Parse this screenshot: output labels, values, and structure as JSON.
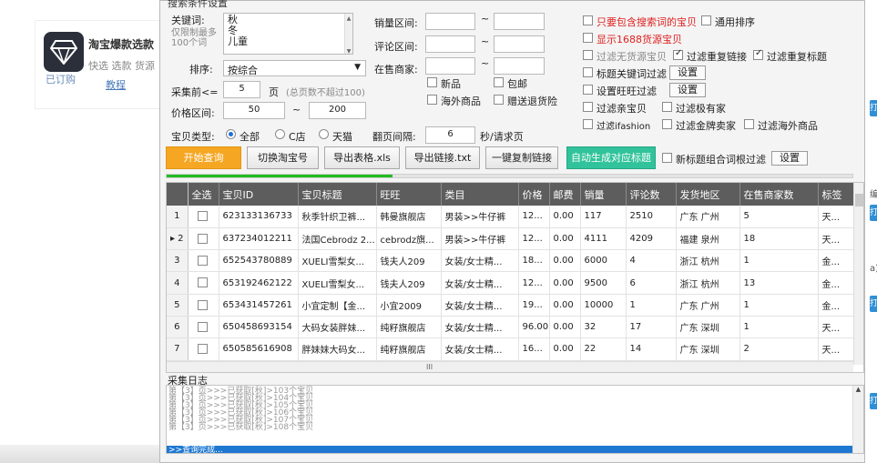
{
  "app_card": {
    "name": "淘宝爆款选款",
    "desc": "快选 选款 货源",
    "subscribed": "已订购",
    "tutorial": "教程"
  },
  "right_edge": {
    "tabs": [
      "打",
      "打",
      "打",
      "打"
    ],
    "texts": [
      "编",
      "a)"
    ]
  },
  "form": {
    "group_title": "搜索条件设置",
    "keyword_label": "关键词:",
    "keyword_hint": "仅限制最多100个词",
    "keyword_values": [
      "秋",
      "冬",
      "儿童"
    ],
    "sort_label": "排序:",
    "sort_value": "按综合",
    "collect_label": "采集前<=",
    "collect_pages": "5",
    "pages_unit": "页",
    "pages_note": "(总页数不超过100)",
    "price_label": "价格区间:",
    "price_from": "50",
    "price_to": "200",
    "tilde": "~",
    "sales_label": "销量区间:",
    "comment_label": "评论区间:",
    "sellers_label": "在售商家:",
    "item_type_label": "宝贝类型:",
    "type_all": "全部",
    "type_c": "C店",
    "type_tmall": "天猫",
    "flip_label": "翻页间隔:",
    "flip_value": "6",
    "flip_unit": "秒/请求页",
    "chk_new": "新品",
    "chk_free_ship": "包邮",
    "chk_overseas": "海外商品",
    "chk_freight_ins": "赠送退货险",
    "opt_only_keyword": "只要包含搜索词的宝贝",
    "opt_general_sort": "通用排序",
    "opt_show_1688": "显示1688货源宝贝",
    "opt_filter_no_source": "过滤无货源宝贝",
    "opt_filter_dup_link": "过滤重复链接",
    "opt_filter_dup_title": "过滤重复标题",
    "opt_title_keyword": "标题关键词过滤",
    "opt_wangwang": "设置旺旺过滤",
    "opt_filter_parent": "过滤亲宝贝",
    "opt_filter_ext": "过滤极有家",
    "opt_filter_ifashion": "过滤ifashion",
    "opt_filter_gold": "过滤金牌卖家",
    "opt_filter_overseas": "过滤海外商品",
    "setting": "设置",
    "opt_new_title": "新标题组合词根过滤"
  },
  "buttons": {
    "start": "开始查询",
    "switch_account": "切换淘宝号",
    "export_xls": "导出表格.xls",
    "export_txt": "导出链接.txt",
    "copy_links": "一键复制链接",
    "auto_title": "自动生成对应标题"
  },
  "progress": 0.33,
  "table": {
    "columns": [
      "全选",
      "宝贝ID",
      "宝贝标题",
      "旺旺",
      "类目",
      "价格",
      "邮费",
      "销量",
      "评论数",
      "发货地区",
      "在售商家数",
      "标签"
    ],
    "rows": [
      {
        "no": "1",
        "id": "623133136733",
        "title": "秋季针织卫裤...",
        "ww": "韩曼旗舰店",
        "cat": "男装>>牛仔裤",
        "price": "12...",
        "ship": "0.00",
        "sales": "117",
        "comments": "2510",
        "area": "广东 广州",
        "sellers": "5",
        "tag": "天..."
      },
      {
        "no": "▸ 2",
        "id": "637234012211",
        "title": "法国Cebrodz 2...",
        "ww": "cebrodz旗...",
        "cat": "男装>>牛仔裤",
        "price": "12...",
        "ship": "0.00",
        "sales": "4111",
        "comments": "4209",
        "area": "福建 泉州",
        "sellers": "18",
        "tag": "天..."
      },
      {
        "no": "3",
        "id": "652543780889",
        "title": "XUELI雪梨女...",
        "ww": "钱夫人209",
        "cat": "女装/女士精...",
        "price": "18...",
        "ship": "0.00",
        "sales": "6000",
        "comments": "4",
        "area": "浙江 杭州",
        "sellers": "1",
        "tag": "金..."
      },
      {
        "no": "4",
        "id": "653192462122",
        "title": "XUELI雪梨女...",
        "ww": "钱夫人209",
        "cat": "女装/女士精...",
        "price": "12...",
        "ship": "0.00",
        "sales": "9500",
        "comments": "6",
        "area": "浙江 杭州",
        "sellers": "13",
        "tag": "金..."
      },
      {
        "no": "5",
        "id": "653431457261",
        "title": "小宜定制【金...",
        "ww": "小宜2009",
        "cat": "女装/女士精...",
        "price": "19...",
        "ship": "0.00",
        "sales": "10000",
        "comments": "1",
        "area": "广东 广州",
        "sellers": "1",
        "tag": "金..."
      },
      {
        "no": "6",
        "id": "650458693154",
        "title": "大码女装胖妹...",
        "ww": "纯籽旗舰店",
        "cat": "女装/女士精...",
        "price": "96.00",
        "ship": "0.00",
        "sales": "32",
        "comments": "17",
        "area": "广东 深圳",
        "sellers": "1",
        "tag": "天..."
      },
      {
        "no": "7",
        "id": "650585616908",
        "title": "胖妹妹大码女...",
        "ww": "纯籽旗舰店",
        "cat": "女装/女士精...",
        "price": "16...",
        "ship": "0.00",
        "sales": "22",
        "comments": "14",
        "area": "广东 深圳",
        "sellers": "2",
        "tag": "天..."
      }
    ],
    "hscroll_mark": "III"
  },
  "log": {
    "title": "采集日志",
    "lines": [
      "第【3】页>>>已获取[秋]>103个宝贝",
      "第【3】页>>>已获取[秋]>104个宝贝",
      "第【3】页>>>已获取[秋]>105个宝贝",
      "第【3】页>>>已获取[秋]>106个宝贝",
      "第【3】页>>>已获取[秋]>107个宝贝",
      "第【3】页>>>已获取[秋]>108个宝贝"
    ],
    "status": ">>查询完成..."
  }
}
